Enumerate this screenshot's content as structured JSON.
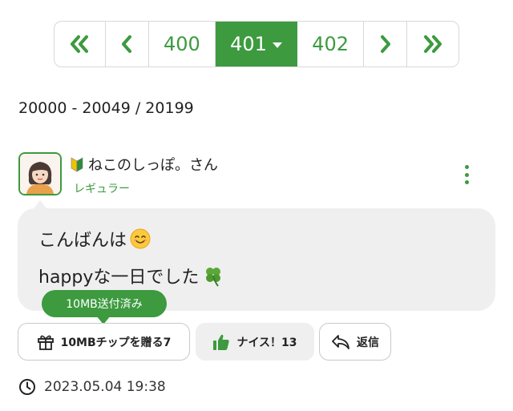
{
  "pagination": {
    "pages": [
      "400",
      "401",
      "402"
    ],
    "current": "401"
  },
  "range_text": "20000 - 20049 / 20199",
  "post": {
    "username": "ねこのしっぽ。さん",
    "level": "レギュラー",
    "line1": "こんばんは",
    "line2": "happyな一日でした",
    "tooltip": "10MB送付済み",
    "tip_button": "10MBチップを贈る7",
    "nice_button": "ナイス！13",
    "reply_button": "返信",
    "timestamp": "2023.05.04 19:38"
  },
  "colors": {
    "accent": "#3d9a3f",
    "bubble": "#efefef",
    "border": "#d9d9d9"
  },
  "icons": [
    "double-chevron-left-icon",
    "chevron-left-icon",
    "caret-down-icon",
    "chevron-right-icon",
    "double-chevron-right-icon",
    "beginner-mark-icon",
    "kebab-menu-icon",
    "smile-emoji-icon",
    "clover-emoji-icon",
    "gift-icon",
    "thumbs-up-icon",
    "reply-icon",
    "clock-icon"
  ]
}
